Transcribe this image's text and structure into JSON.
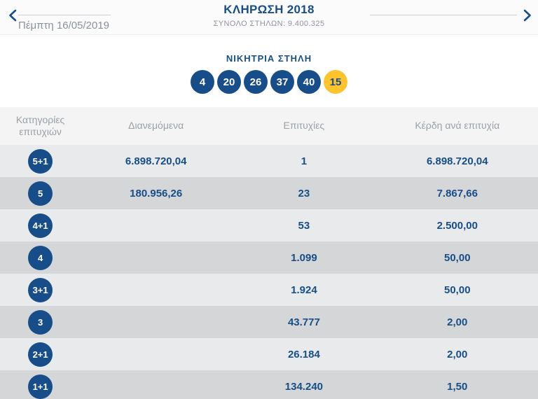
{
  "header": {
    "title": "ΚΛΗΡΩΣΗ 2018",
    "subtitle": "ΣΥΝΟΛΟ ΣΤΗΛΩΝ: 9.400.325",
    "date": "Πέμπτη 16/05/2019"
  },
  "winning": {
    "label": "ΝΙΚΗΤΡΙΑ ΣΤΗΛΗ",
    "balls": [
      {
        "value": "4",
        "type": "main"
      },
      {
        "value": "20",
        "type": "main"
      },
      {
        "value": "26",
        "type": "main"
      },
      {
        "value": "37",
        "type": "main"
      },
      {
        "value": "40",
        "type": "main"
      },
      {
        "value": "15",
        "type": "bonus"
      }
    ]
  },
  "table": {
    "columns": {
      "category": "Κατηγορίες επιτυχιών",
      "distributed": "Διανεμόμενα",
      "winners": "Επιτυχίες",
      "prize": "Κέρδη ανά επιτυχία"
    },
    "rows": [
      {
        "category": "5+1",
        "distributed": "6.898.720,04",
        "winners": "1",
        "prize": "6.898.720,04"
      },
      {
        "category": "5",
        "distributed": "180.956,26",
        "winners": "23",
        "prize": "7.867,66"
      },
      {
        "category": "4+1",
        "distributed": "",
        "winners": "53",
        "prize": "2.500,00"
      },
      {
        "category": "4",
        "distributed": "",
        "winners": "1.099",
        "prize": "50,00"
      },
      {
        "category": "3+1",
        "distributed": "",
        "winners": "1.924",
        "prize": "50,00"
      },
      {
        "category": "3",
        "distributed": "",
        "winners": "43.777",
        "prize": "2,00"
      },
      {
        "category": "2+1",
        "distributed": "",
        "winners": "26.184",
        "prize": "2,00"
      },
      {
        "category": "1+1",
        "distributed": "",
        "winners": "134.240",
        "prize": "1,50"
      }
    ]
  },
  "colors": {
    "accent_blue": "#174e89",
    "bonus_yellow": "#fdc42d",
    "row_light": "#e9eaeb",
    "row_dark": "#d4d6d8",
    "header_bg": "#f4f4f5",
    "muted_gray": "#9aa0a5"
  }
}
